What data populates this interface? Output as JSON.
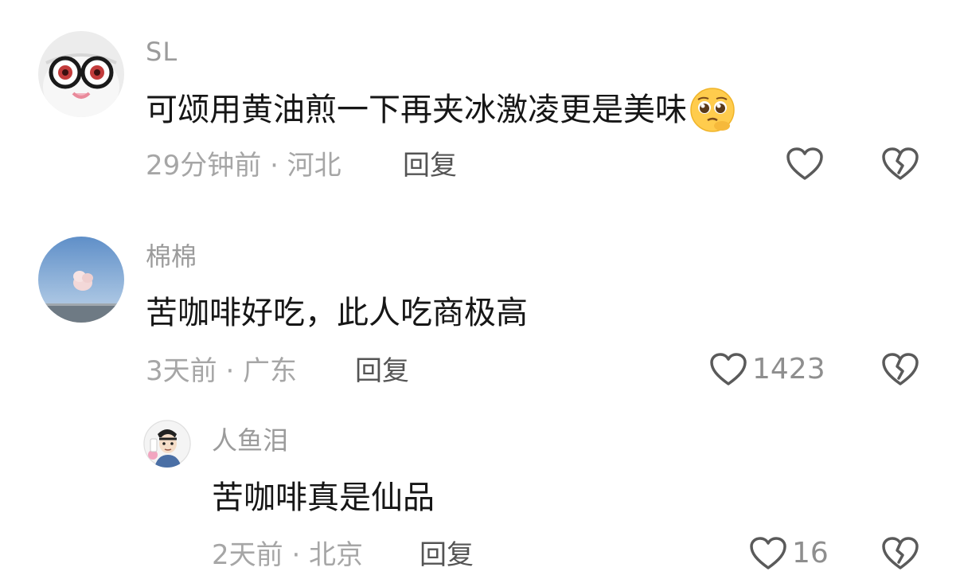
{
  "comments": [
    {
      "username": "SL",
      "content": "可颂用黄油煎一下再夹冰激凌更是美味",
      "emoji": "pleading-face",
      "meta": "29分钟前 · 河北",
      "reply_label": "回复",
      "likes": ""
    },
    {
      "username": "棉棉",
      "content": "苦咖啡好吃，此人吃商极高",
      "meta": "3天前 · 广东",
      "reply_label": "回复",
      "likes": "1423"
    },
    {
      "username": "人鱼泪",
      "content": "苦咖啡真是仙品",
      "meta": "2天前 · 北京",
      "reply_label": "回复",
      "likes": "16",
      "is_reply": true
    }
  ],
  "icons": {
    "like": "heart-outline-icon",
    "dislike": "broken-heart-outline-icon"
  },
  "colors": {
    "background": "#ffffff",
    "text_primary": "#161616",
    "text_secondary": "#9b9b9b",
    "reply_text": "#545454",
    "icon_stroke": "#5a5a5a"
  }
}
